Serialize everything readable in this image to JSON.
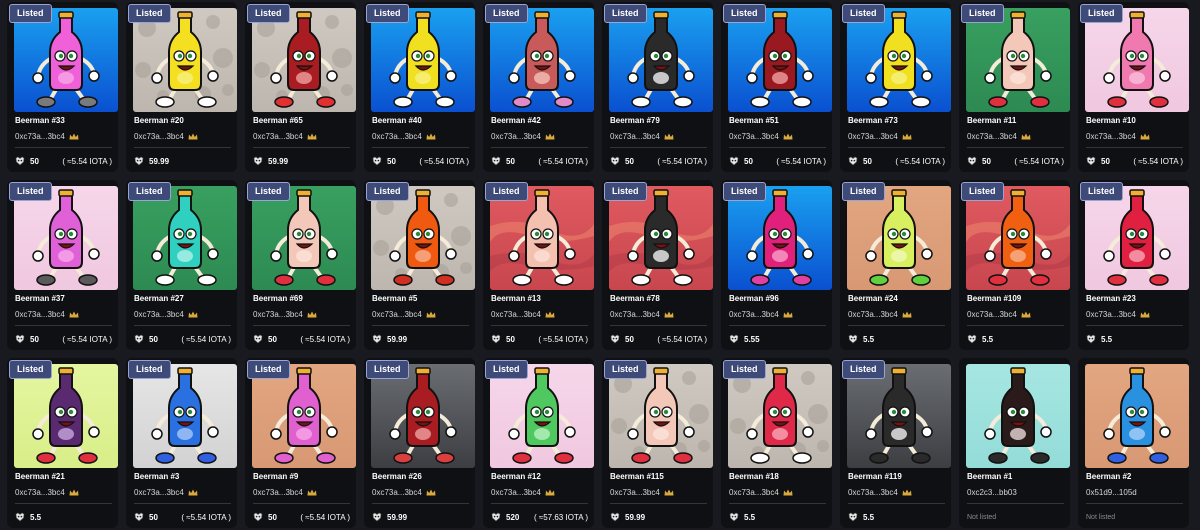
{
  "badge_label": "Listed",
  "not_listed_label": "Not listed",
  "colors": {
    "page_bg": "#191a1f",
    "card_bg": "#0f1013",
    "badge_bg": "#3e4a77",
    "crown": "#d8a93c"
  },
  "cards": [
    {
      "name": "Beerman #33",
      "owner": "0xc73a...3bc4",
      "crown": true,
      "listed": true,
      "price": "50",
      "iota": "( ≈5.54 IOTA )",
      "coin": "coin-icon",
      "bg": "blue",
      "bottle": "#f060d8",
      "label": "#f8a8e8",
      "shoes": "#7a7a7a"
    },
    {
      "name": "Beerman #20",
      "owner": "0xc73a...3bc4",
      "crown": true,
      "listed": true,
      "price": "59.99",
      "iota": "",
      "coin": "coin-icon",
      "bg": "dots",
      "bottle": "#f4e020",
      "label": "#f8f080",
      "shoes": "#ffffff"
    },
    {
      "name": "Beerman #65",
      "owner": "0xc73a...3bc4",
      "crown": true,
      "listed": true,
      "price": "59.99",
      "iota": "",
      "coin": "coin-icon",
      "bg": "dots",
      "bottle": "#a81c22",
      "label": "#f0a0a0",
      "shoes": "#e03030"
    },
    {
      "name": "Beerman #40",
      "owner": "0xc73a...3bc4",
      "crown": true,
      "listed": true,
      "price": "50",
      "iota": "( ≈5.54 IOTA )",
      "coin": "coin-icon",
      "bg": "blue",
      "bottle": "#f0e020",
      "label": "#f8f080",
      "shoes": "#ffffff"
    },
    {
      "name": "Beerman #42",
      "owner": "0xc73a...3bc4",
      "crown": true,
      "listed": true,
      "price": "50",
      "iota": "( ≈5.54 IOTA )",
      "coin": "coin-icon",
      "bg": "blue",
      "bottle": "#c85a5a",
      "label": "#f4c0b8",
      "shoes": "#e08ac8"
    },
    {
      "name": "Beerman #79",
      "owner": "0xc73a...3bc4",
      "crown": true,
      "listed": true,
      "price": "50",
      "iota": "( ≈5.54 IOTA )",
      "coin": "coin-icon",
      "bg": "blue",
      "bottle": "#2a2a2a",
      "label": "#f0f0f0",
      "shoes": "#ffffff"
    },
    {
      "name": "Beerman #51",
      "owner": "0xc73a...3bc4",
      "crown": true,
      "listed": true,
      "price": "50",
      "iota": "( ≈5.54 IOTA )",
      "coin": "coin-icon",
      "bg": "blue",
      "bottle": "#9a1820",
      "label": "#f0a0a0",
      "shoes": "#ffffff"
    },
    {
      "name": "Beerman #73",
      "owner": "0xc73a...3bc4",
      "crown": true,
      "listed": true,
      "price": "50",
      "iota": "( ≈5.54 IOTA )",
      "coin": "coin-icon",
      "bg": "blue",
      "bottle": "#f0e020",
      "label": "#f8f080",
      "shoes": "#ffffff"
    },
    {
      "name": "Beerman #11",
      "owner": "0xc73a...3bc4",
      "crown": true,
      "listed": true,
      "price": "50",
      "iota": "( ≈5.54 IOTA )",
      "coin": "coin-icon",
      "bg": "green",
      "bottle": "#f4c8b8",
      "label": "#fbe4da",
      "shoes": "#e03040"
    },
    {
      "name": "Beerman #10",
      "owner": "0xc73a...3bc4",
      "crown": true,
      "listed": true,
      "price": "50",
      "iota": "( ≈5.54 IOTA )",
      "coin": "coin-icon",
      "bg": "pink",
      "bottle": "#f07ab0",
      "label": "#f8c0d8",
      "shoes": "#e03040"
    },
    {
      "name": "Beerman #37",
      "owner": "0xc73a...3bc4",
      "crown": true,
      "listed": true,
      "price": "50",
      "iota": "( ≈5.54 IOTA )",
      "coin": "coin-icon",
      "bg": "pink",
      "bottle": "#e060d8",
      "label": "#f8a8e8",
      "shoes": "#5a5a5a"
    },
    {
      "name": "Beerman #27",
      "owner": "0xc73a...3bc4",
      "crown": true,
      "listed": true,
      "price": "50",
      "iota": "( ≈5.54 IOTA )",
      "coin": "coin-icon",
      "bg": "green",
      "bottle": "#30d0c0",
      "label": "#b0f0e8",
      "shoes": "#ffffff"
    },
    {
      "name": "Beerman #69",
      "owner": "0xc73a...3bc4",
      "crown": true,
      "listed": true,
      "price": "50",
      "iota": "( ≈5.54 IOTA )",
      "coin": "coin-icon",
      "bg": "green",
      "bottle": "#f4c8b8",
      "label": "#fbe4da",
      "shoes": "#e03040"
    },
    {
      "name": "Beerman #5",
      "owner": "0xc73a...3bc4",
      "crown": true,
      "listed": true,
      "price": "59.99",
      "iota": "",
      "coin": "coin-icon",
      "bg": "dots",
      "bottle": "#f05a10",
      "label": "#f8b090",
      "shoes": "#d03020"
    },
    {
      "name": "Beerman #13",
      "owner": "0xc73a...3bc4",
      "crown": true,
      "listed": true,
      "price": "50",
      "iota": "( ≈5.54 IOTA )",
      "coin": "coin-icon",
      "bg": "sunset",
      "bottle": "#f4c0b0",
      "label": "#fbe0d6",
      "shoes": "#ffffff"
    },
    {
      "name": "Beerman #78",
      "owner": "0xc73a...3bc4",
      "crown": true,
      "listed": true,
      "price": "50",
      "iota": "( ≈5.54 IOTA )",
      "coin": "coin-icon",
      "bg": "sunset",
      "bottle": "#2a2a2a",
      "label": "#f0f0f0",
      "shoes": "#ffffff"
    },
    {
      "name": "Beerman #96",
      "owner": "0xc73a...3bc4",
      "crown": true,
      "listed": true,
      "price": "5.55",
      "iota": "",
      "coin": "coin-icon",
      "bg": "blue",
      "bottle": "#e0207a",
      "label": "#f8a0c8",
      "shoes": "#e040a0"
    },
    {
      "name": "Beerman #24",
      "owner": "0xc73a...3bc4",
      "crown": true,
      "listed": true,
      "price": "5.5",
      "iota": "",
      "coin": "coin-icon",
      "bg": "tan",
      "bottle": "#d8f060",
      "label": "#f0f8b8",
      "shoes": "#60d040"
    },
    {
      "name": "Beerman #109",
      "owner": "0xc73a...3bc4",
      "crown": true,
      "listed": true,
      "price": "5.5",
      "iota": "",
      "coin": "coin-icon",
      "bg": "sunset",
      "bottle": "#f06010",
      "label": "#f8b090",
      "shoes": "#e03040"
    },
    {
      "name": "Beerman #23",
      "owner": "0xc73a...3bc4",
      "crown": true,
      "listed": true,
      "price": "5.5",
      "iota": "",
      "coin": "coin-icon",
      "bg": "pink",
      "bottle": "#e02040",
      "label": "#f8a8b8",
      "shoes": "#e03040"
    },
    {
      "name": "Beerman #21",
      "owner": "0xc73a...3bc4",
      "crown": true,
      "listed": true,
      "price": "5.5",
      "iota": "",
      "coin": "coin-icon",
      "bg": "lime",
      "bottle": "#5a2a70",
      "label": "#c8a8e0",
      "shoes": "#e03040"
    },
    {
      "name": "Beerman #3",
      "owner": "0xc73a...3bc4",
      "crown": true,
      "listed": true,
      "price": "50",
      "iota": "( ≈5.54 IOTA )",
      "coin": "coin-icon",
      "bg": "grey",
      "bottle": "#2a70e0",
      "label": "#a8c8f8",
      "shoes": "#3060e0"
    },
    {
      "name": "Beerman #9",
      "owner": "0xc73a...3bc4",
      "crown": true,
      "listed": true,
      "price": "50",
      "iota": "( ≈5.54 IOTA )",
      "coin": "coin-icon",
      "bg": "tan",
      "bottle": "#e060d0",
      "label": "#f8a8e8",
      "shoes": "#e060d0"
    },
    {
      "name": "Beerman #26",
      "owner": "0xc73a...3bc4",
      "crown": true,
      "listed": true,
      "price": "59.99",
      "iota": "",
      "coin": "coin-icon",
      "bg": "steel",
      "bottle": "#a81c22",
      "label": "#f0a0a0",
      "shoes": "#d84040"
    },
    {
      "name": "Beerman #12",
      "owner": "0xc73a...3bc4",
      "crown": true,
      "listed": true,
      "price": "520",
      "iota": "( ≈57.63 IOTA )",
      "coin": "coin-icon",
      "bg": "pink",
      "bottle": "#50c860",
      "label": "#b8f0c0",
      "shoes": "#e03040"
    },
    {
      "name": "Beerman #115",
      "owner": "0xc73a...3bc4",
      "crown": true,
      "listed": true,
      "price": "59.99",
      "iota": "",
      "coin": "coin-icon",
      "bg": "dots",
      "bottle": "#f4c8b8",
      "label": "#fbe4da",
      "shoes": "#e03040"
    },
    {
      "name": "Beerman #18",
      "owner": "0xc73a...3bc4",
      "crown": true,
      "listed": true,
      "price": "5.5",
      "iota": "",
      "coin": "coin-icon",
      "bg": "dots",
      "bottle": "#e02848",
      "label": "#f8a8b8",
      "shoes": "#ffffff"
    },
    {
      "name": "Beerman #119",
      "owner": "0xc73a...3bc4",
      "crown": true,
      "listed": true,
      "price": "5.5",
      "iota": "",
      "coin": "coin-icon",
      "bg": "steel",
      "bottle": "#2a2a2a",
      "label": "#f0f0f0",
      "shoes": "#2a2a2a"
    },
    {
      "name": "Beerman #1",
      "owner": "0xc2c3...bb03",
      "crown": false,
      "listed": false,
      "price": "",
      "iota": "",
      "coin": "",
      "bg": "aqua",
      "bottle": "#2a1a1a",
      "label": "#e8d8d8",
      "shoes": "#2a2a2a"
    },
    {
      "name": "Beerman #2",
      "owner": "0x51d9...105d",
      "crown": false,
      "listed": false,
      "price": "",
      "iota": "",
      "coin": "",
      "bg": "tan",
      "bottle": "#2a90e0",
      "label": "#a8d0f8",
      "shoes": "#3060e0"
    }
  ]
}
